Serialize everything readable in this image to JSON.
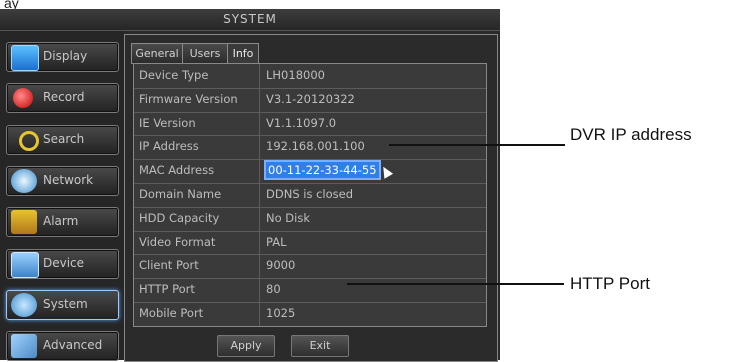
{
  "caption_top": "ay",
  "window": {
    "title": "SYSTEM"
  },
  "sidebar": {
    "items": [
      {
        "label": "Display",
        "icon": "monitor-icon"
      },
      {
        "label": "Record",
        "icon": "record-icon"
      },
      {
        "label": "Search",
        "icon": "search-icon"
      },
      {
        "label": "Network",
        "icon": "network-icon"
      },
      {
        "label": "Alarm",
        "icon": "alarm-icon"
      },
      {
        "label": "Device",
        "icon": "device-icon"
      },
      {
        "label": "System",
        "icon": "system-gear-icon",
        "active": true
      },
      {
        "label": "Advanced",
        "icon": "advanced-tools-icon"
      }
    ]
  },
  "tabs": [
    {
      "label": "General"
    },
    {
      "label": "Users"
    },
    {
      "label": "Info",
      "active": true
    }
  ],
  "info_table": [
    {
      "label": "Device Type",
      "value": "LH018000"
    },
    {
      "label": "Firmware Version",
      "value": "V3.1-20120322"
    },
    {
      "label": "IE Version",
      "value": "V1.1.1097.0"
    },
    {
      "label": "IP Address",
      "value": "192.168.001.100"
    },
    {
      "label": "MAC Address",
      "value": "00-11-22-33-44-55",
      "highlighted": true
    },
    {
      "label": "Domain Name",
      "value": "DDNS is closed"
    },
    {
      "label": "HDD Capacity",
      "value": "No Disk"
    },
    {
      "label": "Video Format",
      "value": "PAL"
    },
    {
      "label": "Client Port",
      "value": "9000"
    },
    {
      "label": "HTTP Port",
      "value": "80"
    },
    {
      "label": "Mobile Port",
      "value": "1025"
    }
  ],
  "buttons": {
    "apply": "Apply",
    "exit": "Exit"
  },
  "callouts": {
    "ip": "DVR IP address",
    "http": "HTTP Port"
  },
  "colors": {
    "highlight": "#2f7fe8",
    "active_glow": "#5aa0ff",
    "background": "#2a2a2a"
  }
}
